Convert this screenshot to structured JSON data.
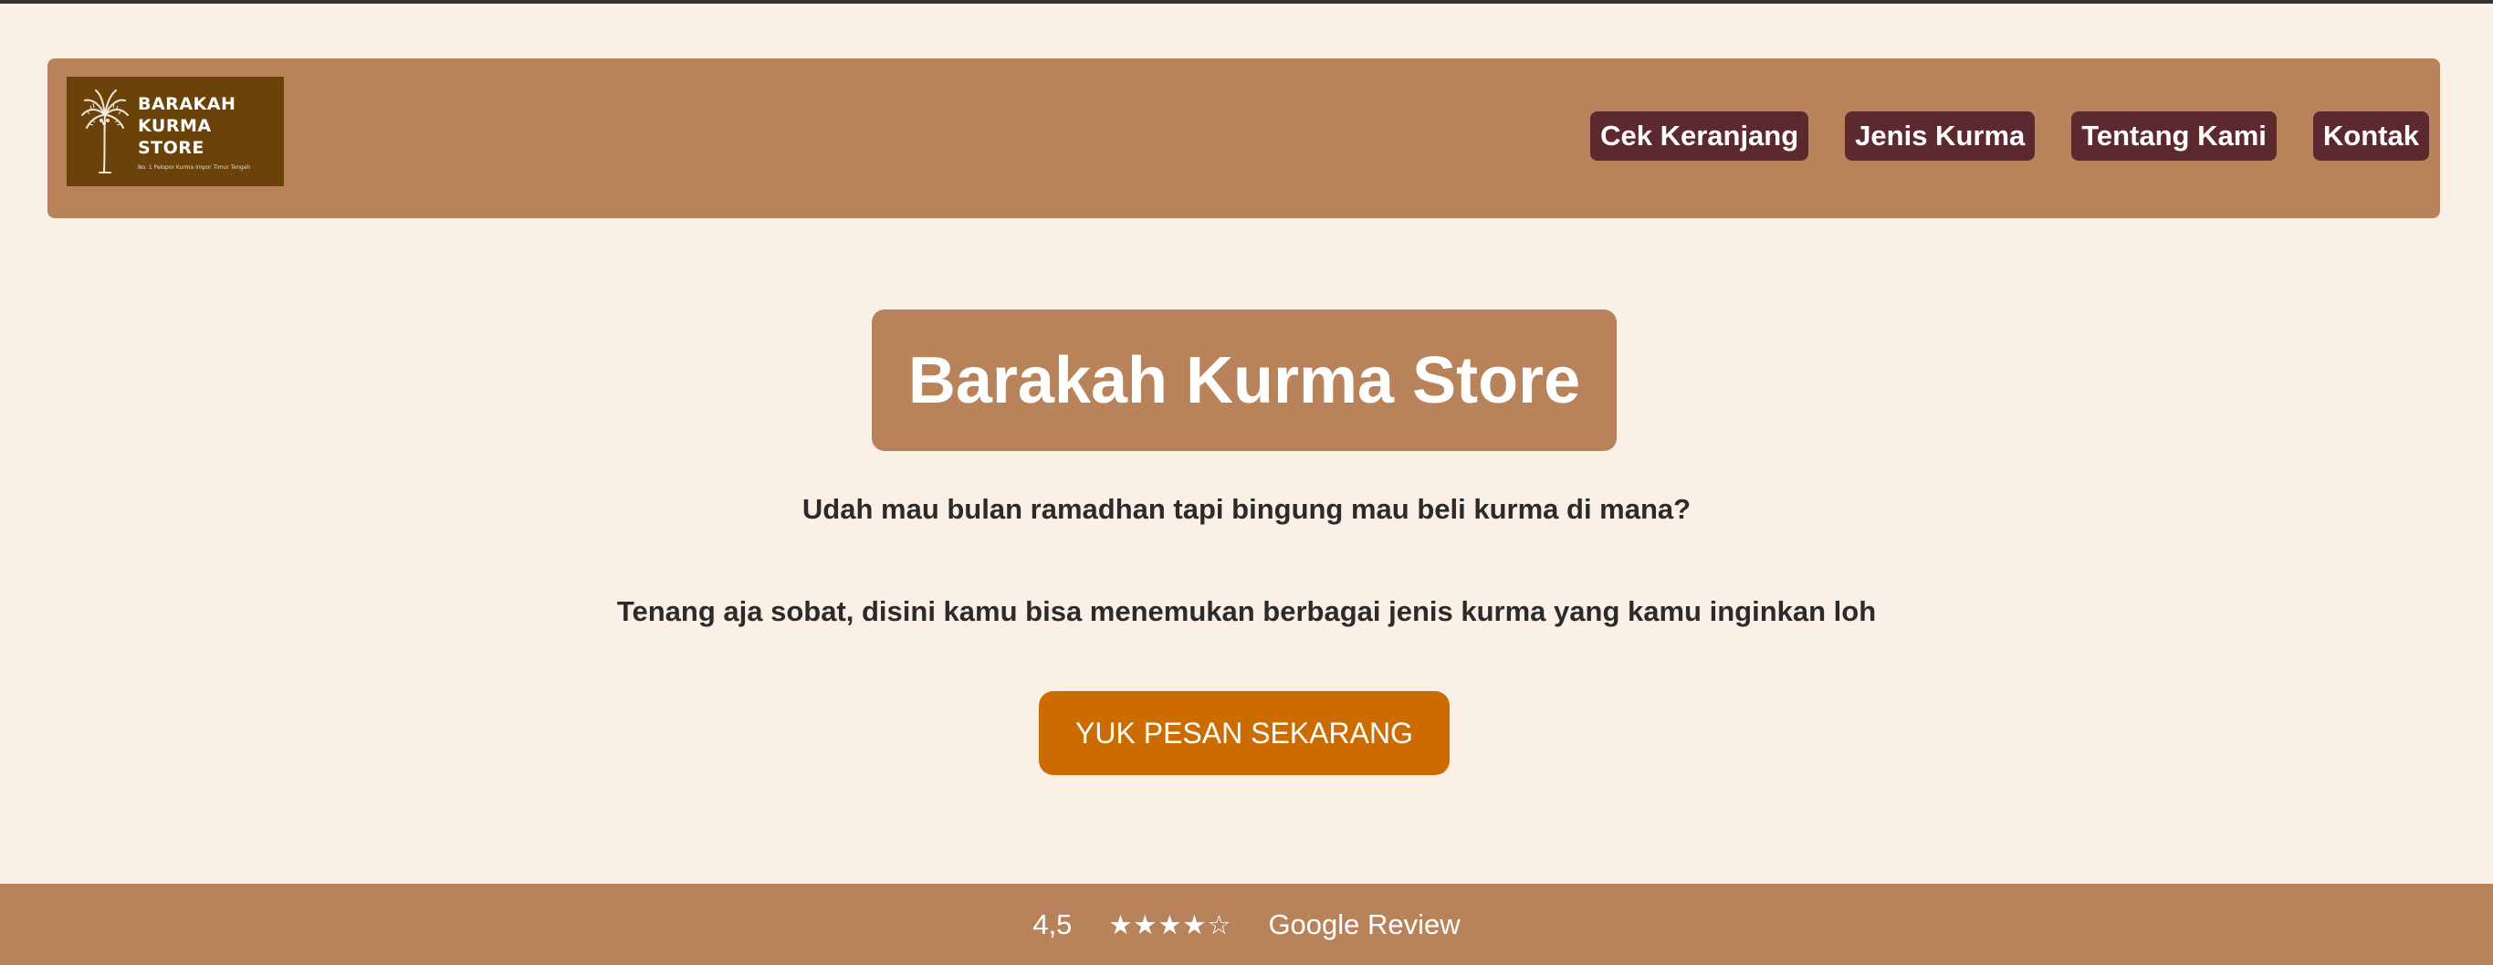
{
  "header": {
    "logo": {
      "title_line1": "BARAKAH",
      "title_line2": "KURMA",
      "title_line3": "STORE",
      "tagline": "No. 1 Pelopor Kurma Impor Timur Tengah",
      "icon": "palm-tree-icon"
    },
    "nav": [
      {
        "label": "Cek Keranjang"
      },
      {
        "label": "Jenis Kurma"
      },
      {
        "label": "Tentang Kami"
      },
      {
        "label": "Kontak"
      }
    ]
  },
  "hero": {
    "title": "Barakah Kurma Store",
    "line1": "Udah mau bulan ramadhan tapi bingung mau beli kurma di mana?",
    "line2": "Tenang aja sobat, disini kamu bisa menemukan berbagai jenis kurma yang kamu inginkan loh",
    "cta_label": "YUK PESAN SEKARANG"
  },
  "footer": {
    "rating": "4,5",
    "stars": "★★★★☆",
    "rating_value": 4.5,
    "rating_max": 5,
    "review_source": "Google Review"
  },
  "colors": {
    "background": "#faf0e6",
    "header_bg": "#b8825a",
    "nav_button_bg": "#5c2a2e",
    "cta_bg": "#cc6c00",
    "logo_bg": "#6b4209"
  }
}
